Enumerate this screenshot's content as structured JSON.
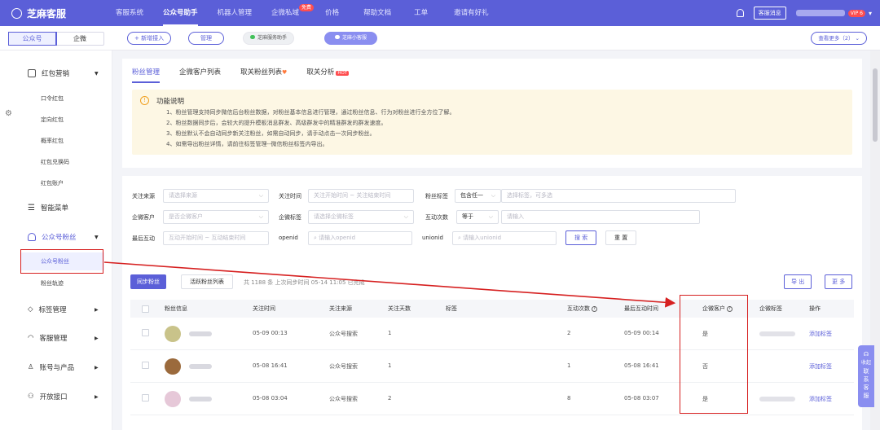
{
  "brand": {
    "name": "芝麻客服"
  },
  "nav": [
    {
      "label": "客服系统"
    },
    {
      "label": "公众号助手"
    },
    {
      "label": "机器人管理"
    },
    {
      "label": "企微私域"
    },
    {
      "label": "价格"
    },
    {
      "label": "帮助文档"
    },
    {
      "label": "工单"
    },
    {
      "label": "邀请有好礼"
    }
  ],
  "nav_badge": "免费",
  "header": {
    "kf_button": "客服消息",
    "vip": "VIP 6"
  },
  "subbar": {
    "seg": [
      "公众号",
      "企微"
    ],
    "add": "+ 新增接入",
    "manage": "管理",
    "pill1": "芝麻服务助手",
    "pill2": "芝麻小客服",
    "more": "查看更多（2）"
  },
  "sidebar": {
    "redpack": "红包营销",
    "subs1": [
      "口令红包",
      "定向红包",
      "概率红包",
      "红包兑换码",
      "红包账户"
    ],
    "menu": "智能菜单",
    "fans": "公众号粉丝",
    "subs2": [
      "公众号粉丝",
      "粉丝轨迹"
    ],
    "tag": "标签管理",
    "service": "客服管理",
    "account": "账号与产品",
    "open": "开放接口"
  },
  "tabs": [
    {
      "label": "粉丝管理"
    },
    {
      "label": "企微客户列表"
    },
    {
      "label": "取关粉丝列表"
    },
    {
      "label": "取关分析"
    }
  ],
  "tab_hot": "HOT",
  "notice": {
    "title": "功能说明",
    "lines": [
      "1、粉丝管理支持同步微信后台粉丝数据，对粉丝基本信息进行管理，通过粉丝信息、行为对粉丝进行全方位了解。",
      "2、粉丝数据同步后，会较大的提升模板消息群发、高级群发中的精准群发的群发速度。",
      "3、粉丝默认不会自动同步新关注粉丝，如需自动同步，请手动点击一次同步粉丝。",
      "4、如需导出粉丝详情，请前往标签管理--微信粉丝标签内导出。"
    ]
  },
  "filters": {
    "source": {
      "label": "关注来源",
      "ph": "请选择来源"
    },
    "time": {
      "label": "关注时间",
      "ph": "关注开始时间 ~ 关注结束时间"
    },
    "tag": {
      "label": "粉丝标签",
      "select": "包含任一",
      "ph": "选择标签，可多选"
    },
    "wecom": {
      "label": "企微客户",
      "ph": "是否企微客户"
    },
    "wtag": {
      "label": "企微标签",
      "ph": "请选择企微标签"
    },
    "count": {
      "label": "互动次数",
      "select": "等于",
      "ph": "请输入"
    },
    "last": {
      "label": "最后互动",
      "ph": "互动开始时间 ~ 互动结束时间"
    },
    "openid": {
      "label": "openid",
      "ph": "请输入openid"
    },
    "unionid": {
      "label": "unionid",
      "ph": "请输入unionid"
    },
    "search": "搜 索",
    "reset": "重 置"
  },
  "toolbar": {
    "sync": "同步粉丝",
    "active": "活跃粉丝列表",
    "info": "共 1188 条 上次同步时间 05-14 11:05 已完成",
    "export": "导 出",
    "more": "更 多"
  },
  "table": {
    "headers": [
      "粉丝信息",
      "关注时间",
      "关注来源",
      "关注天数",
      "标签",
      "互动次数",
      "最后互动时间",
      "企微客户",
      "企微标签",
      "操作"
    ],
    "rows": [
      {
        "time": "05-09 00:13",
        "source": "公众号搜索",
        "days": "1",
        "count": "2",
        "last": "05-09 00:14",
        "wecom": "是",
        "action": "添加标签",
        "avatar": "#c9c38a"
      },
      {
        "time": "05-08 16:41",
        "source": "公众号搜索",
        "days": "1",
        "count": "1",
        "last": "05-08 16:41",
        "wecom": "否",
        "action": "添加标签",
        "avatar": "#9b6a3c"
      },
      {
        "time": "05-08 03:04",
        "source": "公众号搜索",
        "days": "2",
        "count": "8",
        "last": "05-08 03:07",
        "wecom": "是",
        "action": "添加标签",
        "avatar": "#e6c8d8"
      }
    ]
  },
  "float": {
    "label": "联系客服",
    "collapse": "收起"
  }
}
